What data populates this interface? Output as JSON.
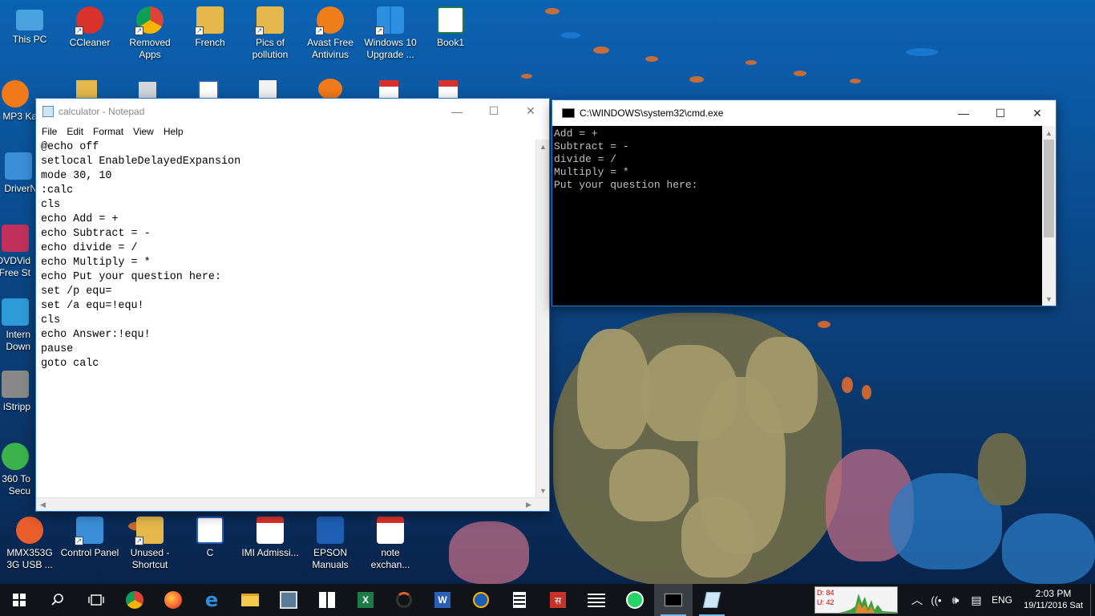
{
  "desktop": {
    "top_icons": [
      {
        "label": "This PC",
        "color": "#4aa3df"
      },
      {
        "label": "CCleaner",
        "color": "#d8322b"
      },
      {
        "label": "Removed Apps",
        "color": "#e9b23a"
      },
      {
        "label": "French",
        "color": "#e4b84a"
      },
      {
        "label": "Pics of pollution",
        "color": "#e4b84a"
      },
      {
        "label": "Avast Free Antivirus",
        "color": "#ef7d1a"
      },
      {
        "label": "Windows 10 Upgrade ...",
        "color": "#2d8fe0"
      },
      {
        "label": "Book1",
        "color": "#1e7b45"
      }
    ],
    "left_icons": [
      {
        "label": "MP3 Ka",
        "color": "#f07a1a"
      },
      {
        "label": "DriverN",
        "color": "#3a8fd8"
      },
      {
        "label": "DVDVid Free St",
        "color": "#c0305a"
      },
      {
        "label": "Intern Down",
        "color": "#2f9ad8"
      },
      {
        "label": "iStripp",
        "color": "#888888"
      },
      {
        "label": "360 To Secu",
        "color": "#3bb34a"
      }
    ],
    "bottom_icons": [
      {
        "label": "MMX353G 3G USB ...",
        "color": "#e85d2a"
      },
      {
        "label": "Control Panel",
        "color": "#3a8fd8"
      },
      {
        "label": "Unused - Shortcut",
        "color": "#e4b84a"
      },
      {
        "label": "C",
        "color": "#2b5fb4"
      },
      {
        "label": "IMI Admissi...",
        "color": "#d8322b"
      },
      {
        "label": "EPSON Manuals",
        "color": "#1e5fb4"
      },
      {
        "label": "note exchan...",
        "color": "#d8322b"
      }
    ]
  },
  "notepad": {
    "title": "calculator - Notepad",
    "menu": [
      "File",
      "Edit",
      "Format",
      "View",
      "Help"
    ],
    "content": "@echo off\nsetlocal EnableDelayedExpansion\nmode 30, 10\n:calc\ncls\necho Add = +\necho Subtract = -\necho divide = /\necho Multiply = *\necho Put your question here:\nset /p equ=\nset /a equ=!equ!\ncls\necho Answer:!equ!\npause\ngoto calc"
  },
  "cmd": {
    "title": "C:\\WINDOWS\\system32\\cmd.exe",
    "output": "Add = +\nSubtract = -\ndivide = /\nMultiply = *\nPut your question here:"
  },
  "window_controls": {
    "minimize": "—",
    "maximize": "☐",
    "close": "✕"
  },
  "taskbar": {
    "items": [
      "start",
      "search",
      "task-view",
      "chrome",
      "firefox",
      "edge",
      "file-explorer",
      "app",
      "store",
      "excel",
      "app2",
      "word",
      "media",
      "calculator",
      "sanskrit-app",
      "app3",
      "whatsapp",
      "cmd",
      "notepad"
    ],
    "net_meter": {
      "down": "D: 84",
      "up": "U: 42"
    },
    "language": "ENG",
    "time": "2:03 PM",
    "date": "19/11/2016 Sat"
  }
}
